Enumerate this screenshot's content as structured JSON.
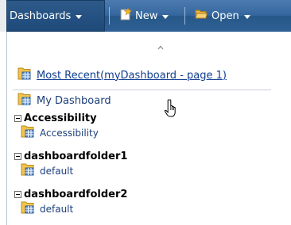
{
  "menubar": {
    "items": [
      {
        "label": "Dashboards",
        "icon": "none"
      },
      {
        "label": "New",
        "icon": "new-document-star-icon"
      },
      {
        "label": "Open",
        "icon": "folder-open-icon"
      }
    ]
  },
  "dropdown": {
    "most_recent": "Most Recent(myDashboard - page 1)",
    "my_dashboard": "My Dashboard",
    "folders": [
      {
        "name": "Accessibility",
        "children": [
          "Accessibility"
        ]
      },
      {
        "name": "dashboardfolder1",
        "children": [
          "default"
        ]
      },
      {
        "name": "dashboardfolder2",
        "children": [
          "default"
        ]
      }
    ]
  },
  "colors": {
    "menubar": "#35679f",
    "link": "#0f3d91",
    "text_blue": "#1c3f7a",
    "folder_yellow": "#f3c44d",
    "grid_blue": "#5b8fc9"
  }
}
